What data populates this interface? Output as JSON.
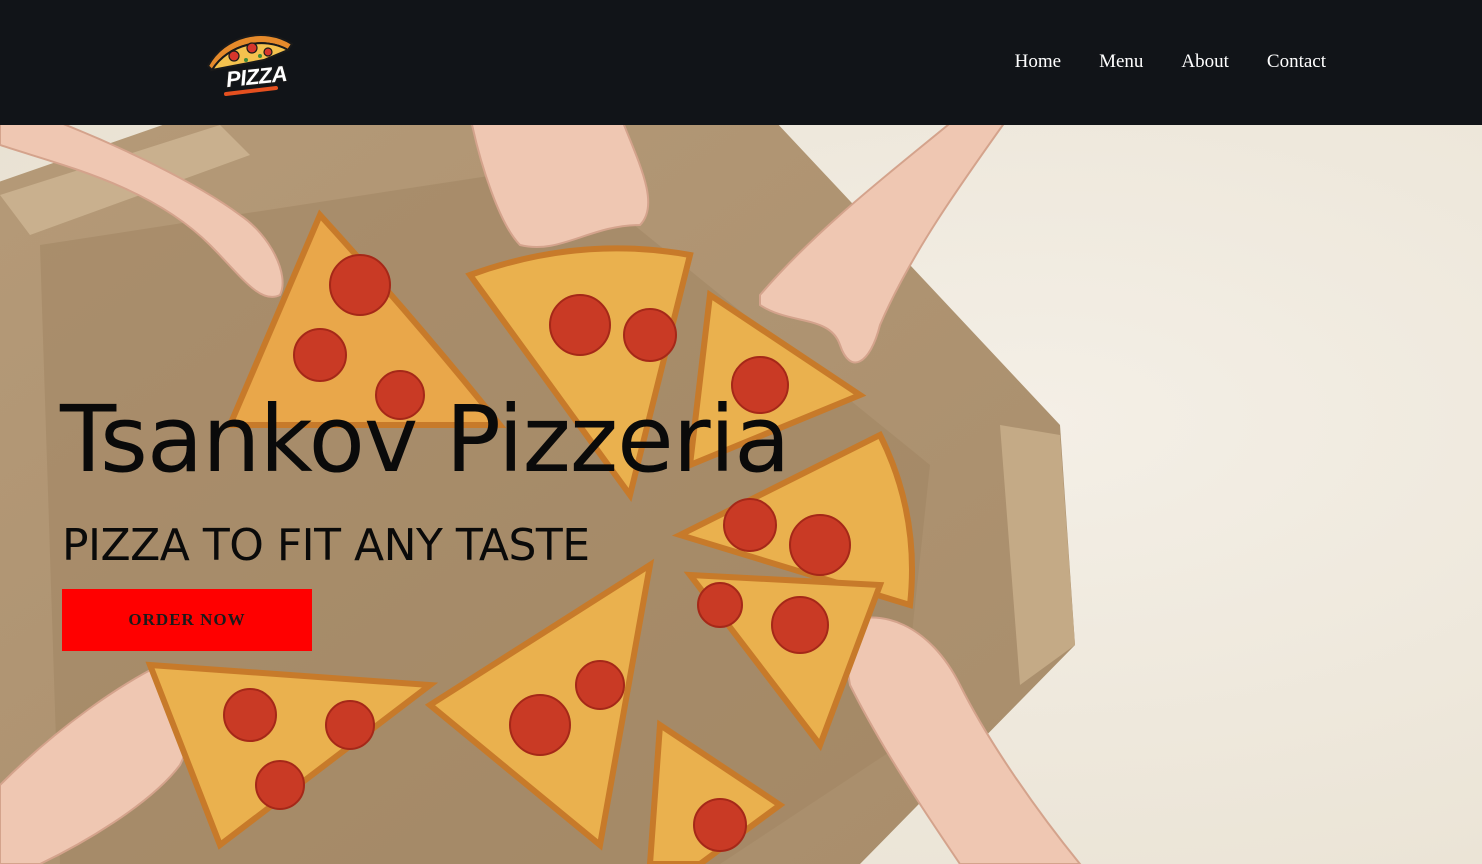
{
  "header": {
    "logo": {
      "icon": "pizza-slice-logo",
      "text": "PIZZA"
    },
    "nav": [
      {
        "label": "Home"
      },
      {
        "label": "Menu"
      },
      {
        "label": "About"
      },
      {
        "label": "Contact"
      }
    ]
  },
  "hero": {
    "title": "Tsankov Pizzeria",
    "subtitle": "PIZZA TO FIT ANY TASTE",
    "cta_label": "ORDER NOW",
    "background_image": "hands-taking-pepperoni-pizza-slices-from-box"
  },
  "colors": {
    "header_bg": "#111418",
    "nav_text": "#ffffff",
    "cta_bg": "#ff0000",
    "title_text": "#0a0a0a"
  }
}
